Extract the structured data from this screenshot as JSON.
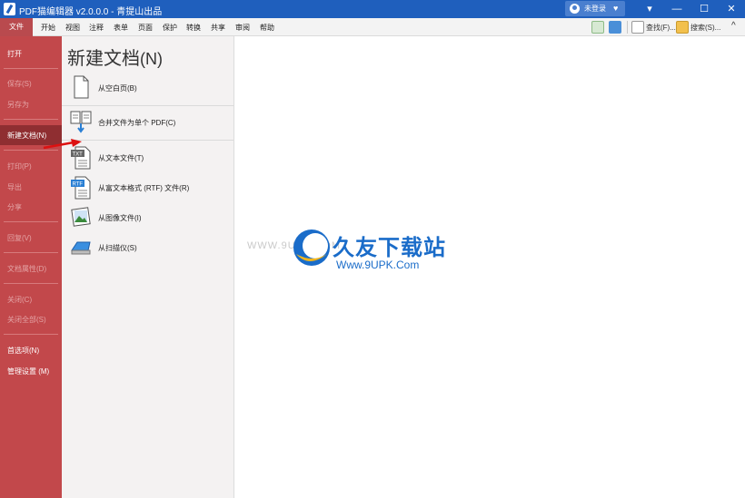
{
  "window": {
    "title": "PDF猫编辑器 v2.0.0.0 - 青提山出品",
    "login_label": "未登录",
    "controls": [
      "▾",
      "—",
      "☐",
      "✕"
    ]
  },
  "menubar": {
    "items": [
      "文件",
      "开始",
      "视图",
      "注释",
      "表单",
      "页面",
      "保护",
      "转换",
      "共享",
      "审阅",
      "帮助"
    ],
    "find_label": "查找(F)...",
    "search_label": "搜索(S)...",
    "collapse": "^"
  },
  "sidebar": {
    "items": [
      {
        "label": "打开",
        "enabled": true
      },
      {
        "label": "保存(S)",
        "enabled": false
      },
      {
        "label": "另存为",
        "enabled": false
      },
      {
        "label": "新建文档(N)",
        "enabled": true,
        "selected": true
      },
      {
        "label": "打印(P)",
        "enabled": false
      },
      {
        "label": "导出",
        "enabled": false
      },
      {
        "label": "分享",
        "enabled": false
      },
      {
        "label": "回复(V)",
        "enabled": false
      },
      {
        "label": "文档属性(D)",
        "enabled": false
      },
      {
        "label": "关闭(C)",
        "enabled": false
      },
      {
        "label": "关闭全部(S)",
        "enabled": false
      },
      {
        "label": "首选项(N)",
        "enabled": true
      },
      {
        "label": "管理设置 (M)",
        "enabled": true
      }
    ]
  },
  "panel": {
    "title": "新建文档",
    "accel": "(N)",
    "options": [
      {
        "label": "从空白页(B)",
        "icon": "blank-page-icon"
      },
      {
        "label": "合并文件为单个 PDF(C)",
        "icon": "merge-files-icon"
      },
      {
        "label": "从文本文件(T)",
        "icon": "txt-file-icon"
      },
      {
        "label": "从富文本格式 (RTF) 文件(R)",
        "icon": "rtf-file-icon"
      },
      {
        "label": "从图像文件(I)",
        "icon": "image-file-icon"
      },
      {
        "label": "从扫描仪(S)",
        "icon": "scanner-icon"
      }
    ]
  },
  "watermark": {
    "small": "WWW.9UPK.COM",
    "big": "久友下载站",
    "url": "Www.9UPK.Com"
  },
  "colors": {
    "titlebar": "#1f5fbd",
    "sidebar": "#c2484b",
    "sidebar_selected": "#8f2e31",
    "brand_blue": "#1a6cc9"
  }
}
